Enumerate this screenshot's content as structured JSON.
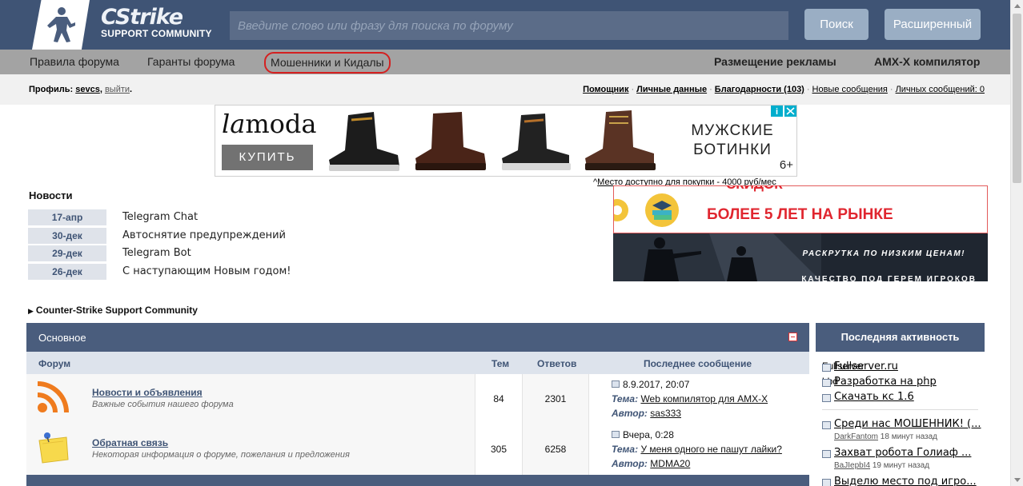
{
  "header": {
    "logo_line1": "CStrike",
    "logo_line2": "SUPPORT COMMUNITY",
    "search_placeholder": "Введите слово или фразу для поиска по форуму",
    "search_button": "Поиск",
    "advanced_button": "Расширенный"
  },
  "nav": {
    "items": [
      "Правила форума",
      "Гаранты форума",
      "Мошенники и Кидалы"
    ],
    "right_items": [
      "Размещение рекламы",
      "AMX-X компилятор"
    ]
  },
  "profile": {
    "label": "Профиль:",
    "username": "sevcs",
    "logout": "выйти",
    "links": [
      "Помощник",
      "Личные данные",
      "Благодарности (103)",
      "Новые сообщения",
      "Личных сообщений: 0"
    ]
  },
  "ad": {
    "brand_prefix": "la",
    "brand_suffix": "moda",
    "buy": "КУПИТЬ",
    "message_line1": "МУЖСКИЕ",
    "message_line2": "БОТИНКИ",
    "age": "6+",
    "note": "Место доступно для покупки - 4000 руб/мес"
  },
  "news": {
    "title": "Новости",
    "items": [
      {
        "date": "17-апр",
        "text": "Telegram Chat"
      },
      {
        "date": "30-дек",
        "text": "Автоснятие предупреждений"
      },
      {
        "date": "29-дек",
        "text": "Telegram Bot"
      },
      {
        "date": "26-дек",
        "text": "С наступающим Новым годом!"
      }
    ]
  },
  "banner": {
    "top_text": "БОЛЕЕ 5 ЛЕТ НА РЫНКЕ",
    "top_cut": "СКИДОК",
    "bottom_text": "РАСКРУТКА ПО НИЗКИМ ЦЕНАМ!",
    "bottom_cut": "КАЧЕСТВО ПОД ГЕРЕМ ИГРОКОВ"
  },
  "breadcrumb": "Counter-Strike Support Community",
  "forum": {
    "title": "Основное",
    "columns": {
      "forum": "Форум",
      "topics": "Тем",
      "replies": "Ответов",
      "last": "Последнее сообщение"
    },
    "rows": [
      {
        "name": "Новости и объявления",
        "desc": "Важные события нашего форума",
        "topics": "84",
        "replies": "2301",
        "last_date": "8.9.2017, 20:07",
        "theme_label": "Тема:",
        "theme": "Web компилятор для AMX-X",
        "author_label": "Автор:",
        "author": "sas333"
      },
      {
        "name": "Обратная связь",
        "desc": "Некоторая информация о форуме, пожелания и предложения",
        "topics": "305",
        "replies": "6258",
        "last_date": "Вчера, 0:28",
        "theme_label": "Тема:",
        "theme": "У меня одного не пашут лайки?",
        "author_label": "Автор:",
        "author": "MDMA20"
      }
    ]
  },
  "activity": {
    "title": "Последняя активность",
    "items": [
      {
        "title": "Fullserver.ru",
        "by": "Fullserver"
      },
      {
        "title": "Разработка на php",
        "by": "bbd"
      },
      {
        "title": "Скачать кс 1.6",
        "by": ""
      },
      {
        "title": "Среди нас МОШЕННИК! (...",
        "user": "DarkFantom",
        "time": "18 минут назад"
      },
      {
        "title": "Захват робота Голиаф ...",
        "user": "BaJIepbI4",
        "time": "19 минут назад"
      },
      {
        "title": "Выделю место под игро...",
        "user": "",
        "time": ""
      }
    ]
  },
  "colors": {
    "header_bg": "#3f5475",
    "nav_bg": "#a3a3a3",
    "accent_red": "#d42020",
    "forum_head": "#4a5d7d"
  }
}
